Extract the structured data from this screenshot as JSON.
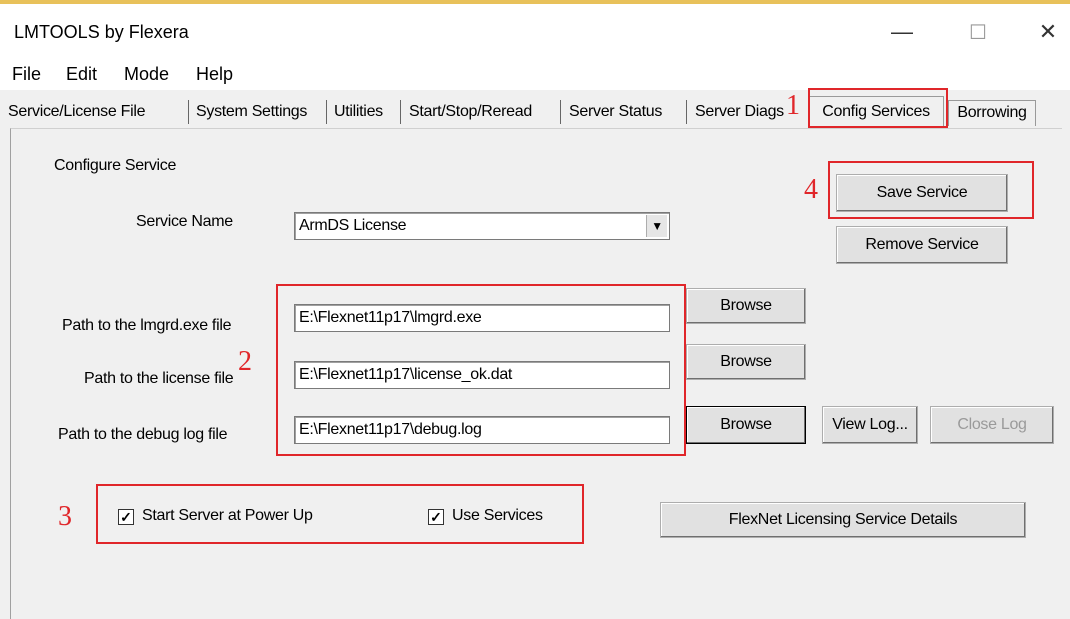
{
  "window": {
    "title": "LMTOOLS by Flexera",
    "controls": {
      "minimize": "—",
      "maximize": "☐",
      "close": "✕"
    }
  },
  "menubar": {
    "items": [
      "File",
      "Edit",
      "Mode",
      "Help"
    ]
  },
  "tabs": {
    "items": [
      "Service/License File",
      "System Settings",
      "Utilities",
      "Start/Stop/Reread",
      "Server Status",
      "Server Diags",
      "Config Services",
      "Borrowing"
    ],
    "active": "Config Services"
  },
  "config": {
    "section_label": "Configure Service",
    "service_name_label": "Service Name",
    "service_name_value": "ArmDS License",
    "save_button": "Save Service",
    "remove_button": "Remove Service",
    "lmgrd_label": "Path to the lmgrd.exe file",
    "lmgrd_value": "E:\\Flexnet11p17\\lmgrd.exe",
    "license_label": "Path to the license file",
    "license_value": "E:\\Flexnet11p17\\license_ok.dat",
    "debug_label": "Path to the debug log file",
    "debug_value": "E:\\Flexnet11p17\\debug.log",
    "browse_button": "Browse",
    "view_log_button": "View Log...",
    "close_log_button": "Close Log",
    "start_at_powerup_label": "Start Server at Power Up",
    "start_at_powerup_checked": true,
    "use_services_label": "Use Services",
    "use_services_checked": true,
    "details_button": "FlexNet Licensing Service Details"
  },
  "annotations": {
    "n1": "1",
    "n2": "2",
    "n3": "3",
    "n4": "4",
    "color": "#e0262a"
  }
}
